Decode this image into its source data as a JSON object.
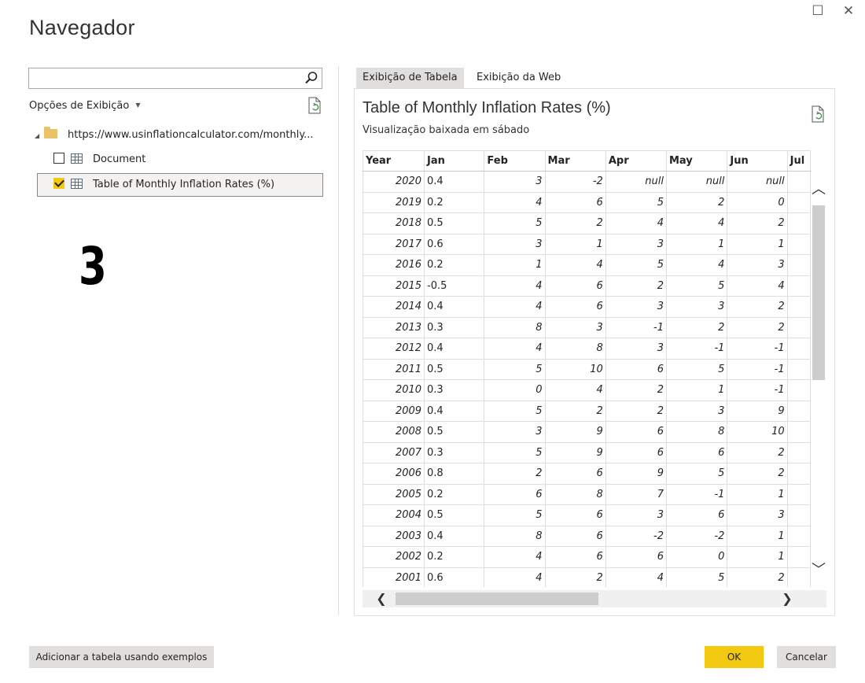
{
  "window": {
    "title": "Navegador",
    "maximize_glyph": "☐",
    "close_glyph": "✕"
  },
  "left": {
    "search": {
      "value": "",
      "placeholder": ""
    },
    "display_options_label": "Opções de Exibição",
    "tree": {
      "root_label": "https://www.usinflationcalculator.com/monthly...",
      "items": [
        {
          "label": "Document",
          "checked": false
        },
        {
          "label": "Table of Monthly Inflation Rates (%)",
          "checked": true
        }
      ]
    },
    "annotation": "3"
  },
  "tabs": [
    {
      "label": "Exibição de Tabela",
      "active": true
    },
    {
      "label": "Exibição da Web",
      "active": false
    }
  ],
  "preview": {
    "title": "Table of Monthly Inflation Rates (%)",
    "subtitle": "Visualização baixada em sábado",
    "columns": [
      "Year",
      "Jan",
      "Feb",
      "Mar",
      "Apr",
      "May",
      "Jun",
      "Jul"
    ],
    "rows": [
      [
        "2020",
        "0.4",
        "3",
        "-2",
        "null",
        "null",
        "null"
      ],
      [
        "2019",
        "0.2",
        "4",
        "6",
        "5",
        "2",
        "0"
      ],
      [
        "2018",
        "0.5",
        "5",
        "2",
        "4",
        "4",
        "2"
      ],
      [
        "2017",
        "0.6",
        "3",
        "1",
        "3",
        "1",
        "1"
      ],
      [
        "2016",
        "0.2",
        "1",
        "4",
        "5",
        "4",
        "3"
      ],
      [
        "2015",
        "-0.5",
        "4",
        "6",
        "2",
        "5",
        "4"
      ],
      [
        "2014",
        "0.4",
        "4",
        "6",
        "3",
        "3",
        "2"
      ],
      [
        "2013",
        "0.3",
        "8",
        "3",
        "-1",
        "2",
        "2"
      ],
      [
        "2012",
        "0.4",
        "4",
        "8",
        "3",
        "-1",
        "-1"
      ],
      [
        "2011",
        "0.5",
        "5",
        "10",
        "6",
        "5",
        "-1"
      ],
      [
        "2010",
        "0.3",
        "0",
        "4",
        "2",
        "1",
        "-1"
      ],
      [
        "2009",
        "0.4",
        "5",
        "2",
        "2",
        "3",
        "9"
      ],
      [
        "2008",
        "0.5",
        "3",
        "9",
        "6",
        "8",
        "10"
      ],
      [
        "2007",
        "0.3",
        "5",
        "9",
        "6",
        "6",
        "2"
      ],
      [
        "2006",
        "0.8",
        "2",
        "6",
        "9",
        "5",
        "2"
      ],
      [
        "2005",
        "0.2",
        "6",
        "8",
        "7",
        "-1",
        "1"
      ],
      [
        "2004",
        "0.5",
        "5",
        "6",
        "3",
        "6",
        "3"
      ],
      [
        "2003",
        "0.4",
        "8",
        "6",
        "-2",
        "-2",
        "1"
      ],
      [
        "2002",
        "0.2",
        "4",
        "6",
        "6",
        "0",
        "1"
      ],
      [
        "2001",
        "0.6",
        "4",
        "2",
        "4",
        "5",
        "2"
      ]
    ]
  },
  "footer": {
    "add_table_label": "Adicionar a tabela usando exemplos",
    "ok_label": "OK",
    "cancel_label": "Cancelar"
  },
  "colors": {
    "accent": "#f2c811",
    "selected_row": "#f3f2f1",
    "button": "#e1dfdd"
  }
}
